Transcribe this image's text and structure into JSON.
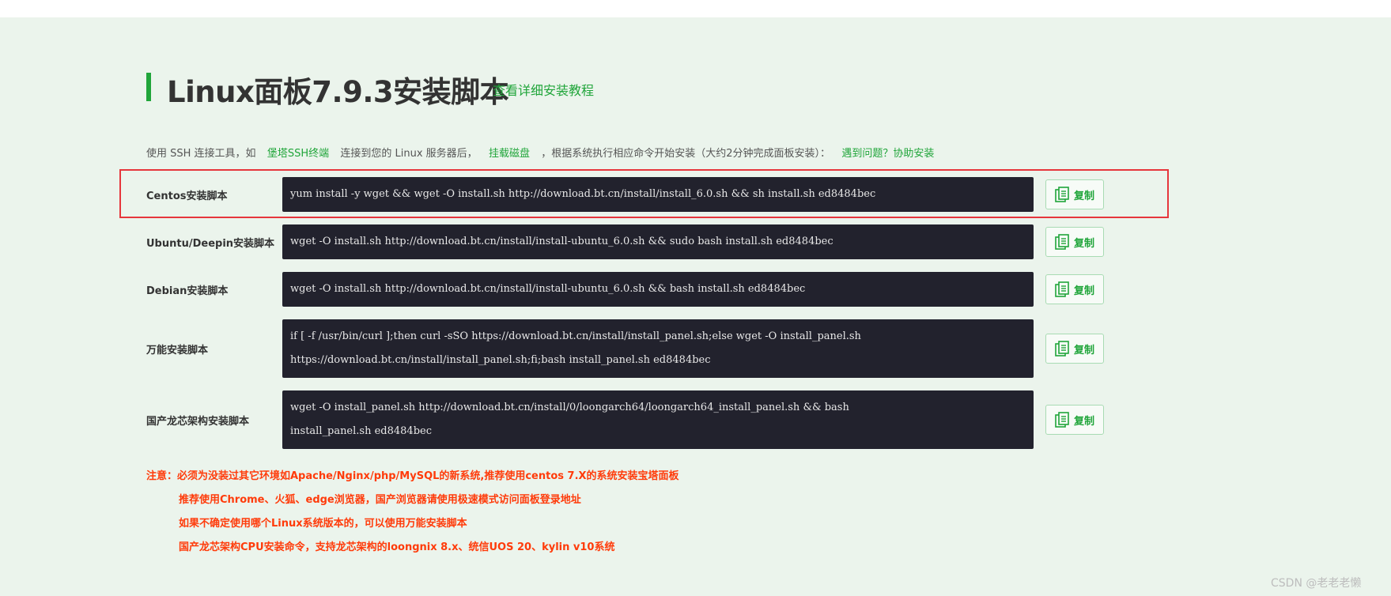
{
  "header": {
    "title": "Linux面板7.9.3安装脚本",
    "tutorial_link": "查看详细安装教程"
  },
  "intro": {
    "part1": "使用 SSH 连接工具，如",
    "ssh_link": "堡塔SSH终端",
    "part2": "连接到您的 Linux 服务器后，",
    "mount_link": "挂载磁盘",
    "part3": "，根据系统执行相应命令开始安装（大约2分钟完成面板安装）：",
    "help_link": "遇到问题？协助安装"
  },
  "copy_label": "复制",
  "scripts": [
    {
      "label": "Centos安装脚本",
      "lines": [
        "yum install -y wget && wget -O install.sh http://download.bt.cn/install/install_6.0.sh && sh install.sh ed8484bec"
      ]
    },
    {
      "label": "Ubuntu/Deepin安装脚本",
      "lines": [
        "wget -O install.sh http://download.bt.cn/install/install-ubuntu_6.0.sh && sudo bash install.sh ed8484bec"
      ]
    },
    {
      "label": "Debian安装脚本",
      "lines": [
        "wget -O install.sh http://download.bt.cn/install/install-ubuntu_6.0.sh && bash install.sh ed8484bec"
      ]
    },
    {
      "label": "万能安装脚本",
      "lines": [
        "if [ -f /usr/bin/curl ];then curl -sSO https://download.bt.cn/install/install_panel.sh;else wget -O install_panel.sh",
        "https://download.bt.cn/install/install_panel.sh;fi;bash install_panel.sh ed8484bec"
      ]
    },
    {
      "label": "国产龙芯架构安装脚本",
      "lines": [
        "wget -O install_panel.sh http://download.bt.cn/install/0/loongarch64/loongarch64_install_panel.sh && bash",
        "install_panel.sh ed8484bec"
      ]
    }
  ],
  "notes": [
    "注意：必须为没装过其它环境如Apache/Nginx/php/MySQL的新系统,推荐使用centos 7.X的系统安装宝塔面板",
    "推荐使用Chrome、火狐、edge浏览器，国产浏览器请使用极速模式访问面板登录地址",
    "如果不确定使用哪个Linux系统版本的，可以使用万能安装脚本",
    "国产龙芯架构CPU安装命令，支持龙芯架构的loongnix 8.x、统信UOS 20、kylin v10系统"
  ],
  "watermark": "CSDN @老老老懒",
  "colors": {
    "accent": "#20a53a",
    "background": "#ebf4ec",
    "command_bg": "#22222d",
    "warning": "#ff3b0a",
    "highlight": "#e6363c"
  }
}
